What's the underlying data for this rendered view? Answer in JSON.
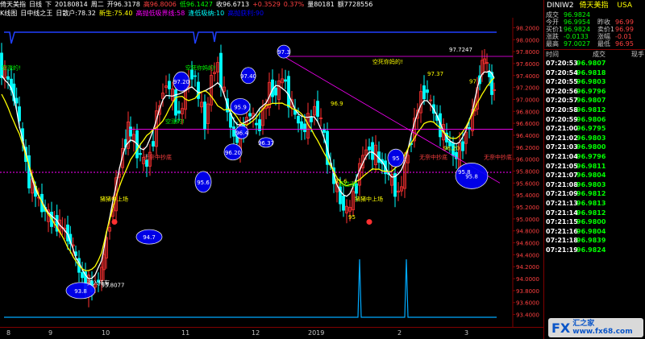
{
  "title_bar": {
    "items": [
      "倚天美指",
      "日线",
      "下",
      "20180814",
      "周二",
      "开96.3178",
      "高96.8006",
      "低96.1427",
      "收96.6713",
      "+0.3529",
      "0.37%",
      "量80181",
      "额7728556"
    ]
  },
  "indicator_bar": {
    "items": [
      "K线图",
      "日中线之王",
      "日散户:78.32",
      "新生:75.40",
      "高抛低吸界线:58",
      "逢低吸纳:10",
      "高抛获利:90"
    ]
  },
  "price_axis": {
    "labels": [
      "98.2000",
      "98.0000",
      "97.8000",
      "97.6000",
      "97.4000",
      "97.2000",
      "97.0000",
      "96.8000",
      "96.6000",
      "96.4000",
      "96.2000",
      "96.0000",
      "95.8000",
      "95.6000",
      "95.4000",
      "95.2000",
      "95.0000",
      "94.8000",
      "94.6000",
      "94.4000",
      "94.2000",
      "94.0000",
      "93.8000",
      "93.6000",
      "93.4000"
    ]
  },
  "x_axis": {
    "labels": [
      "8",
      "9",
      "10",
      "11",
      "12",
      "2019",
      "2",
      "3"
    ]
  },
  "annotations": {
    "bubbles": [
      "93.8",
      "94.7",
      "95.6",
      "96.20",
      "95.9",
      "96.4",
      "96.37",
      "97.20",
      "97.3",
      "97.40",
      "95.8",
      "95",
      "93.8077"
    ],
    "texts": [
      "空涨的!",
      "买入持有",
      "猪猪中上场",
      "无奈中抄底",
      "空死你妈的!",
      "空死你妈的!",
      "猪猪中上场",
      "无奈中抄底",
      "无奈中抄底",
      "空涨的!",
      "高位涨!",
      "97.7247",
      "97.37",
      "96.9",
      "96.20",
      "95.6",
      "95",
      "97",
      "95.8"
    ]
  },
  "quote": {
    "symbol": "DINIW2",
    "name": "倚天美指",
    "market": "USA",
    "rows": [
      {
        "k": "成交",
        "v": "96.9824",
        "k2": "",
        "v2": ""
      },
      {
        "k": "今开",
        "v": "96.9954",
        "k2": "昨收",
        "v2": "96.99"
      },
      {
        "k": "买价1",
        "v": "96.9824",
        "k2": "卖价1",
        "v2": "96.99"
      },
      {
        "k": "涨跌",
        "v": "-0.0133",
        "k2": "涨幅",
        "v2": "-0.01"
      },
      {
        "k": "最高",
        "v": "97.0027",
        "k2": "最低",
        "v2": "96.95"
      }
    ]
  },
  "ticks": {
    "headers": [
      "时间",
      "成交",
      "现手"
    ],
    "rows": [
      {
        "t": "07:20:53",
        "p": "96.9807"
      },
      {
        "t": "07:20:54",
        "p": "96.9818"
      },
      {
        "t": "07:20:55",
        "p": "96.9803"
      },
      {
        "t": "07:20:56",
        "p": "96.9796"
      },
      {
        "t": "07:20:57",
        "p": "96.9807"
      },
      {
        "t": "07:20:58",
        "p": "96.9812"
      },
      {
        "t": "07:20:59",
        "p": "96.9806"
      },
      {
        "t": "07:21:00",
        "p": "96.9795"
      },
      {
        "t": "07:21:02",
        "p": "96.9803"
      },
      {
        "t": "07:21:03",
        "p": "96.9800"
      },
      {
        "t": "07:21:04",
        "p": "96.9796"
      },
      {
        "t": "07:21:05",
        "p": "96.9811"
      },
      {
        "t": "07:21:07",
        "p": "96.9804"
      },
      {
        "t": "07:21:08",
        "p": "96.9803"
      },
      {
        "t": "07:21:09",
        "p": "96.9812"
      },
      {
        "t": "07:21:13",
        "p": "96.9813"
      },
      {
        "t": "07:21:14",
        "p": "96.9812"
      },
      {
        "t": "07:21:15",
        "p": "96.9800"
      },
      {
        "t": "07:21:16",
        "p": "96.9804"
      },
      {
        "t": "07:21:18",
        "p": "96.9839"
      },
      {
        "t": "07:21:19",
        "p": "96.9824"
      }
    ]
  },
  "watermark": {
    "logo": "FX",
    "text1": "汇之家",
    "text2": "www.fx68.com"
  },
  "colors": {
    "up_candle": "#ff3232",
    "down_candle": "#00ffff",
    "line_white": "#ffffff",
    "line_yellow": "#ffff00",
    "bubble": "#0000ff",
    "resist": "#ff00ff",
    "volume": "#00aaff"
  }
}
